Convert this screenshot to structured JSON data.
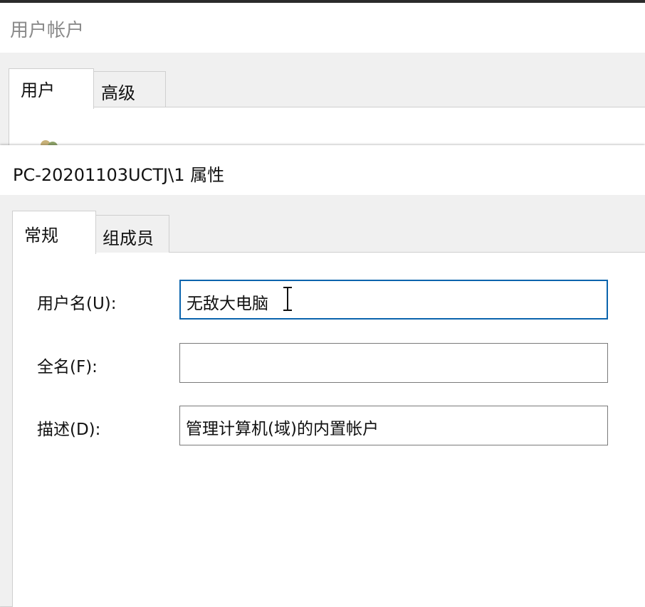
{
  "background_window": {
    "title": "用户帐户",
    "tabs": [
      {
        "label": "用户",
        "active": true
      },
      {
        "label": "高级",
        "active": false
      }
    ],
    "icon": "users-icon"
  },
  "dialog": {
    "title": "PC-20201103UCTJ\\1 属性",
    "tabs": [
      {
        "label": "常规",
        "active": true
      },
      {
        "label": "组成员",
        "active": false
      }
    ],
    "fields": [
      {
        "label": "用户名(U):",
        "value": "无敌大电脑",
        "focused": true
      },
      {
        "label": "全名(F):",
        "value": "",
        "focused": false
      },
      {
        "label": "描述(D):",
        "value": "管理计算机(域)的内置帐户",
        "focused": false
      }
    ]
  },
  "colors": {
    "focus_border": "#0a64ad",
    "field_border": "#7a7a7a",
    "window_bg": "#f0f0f0"
  }
}
